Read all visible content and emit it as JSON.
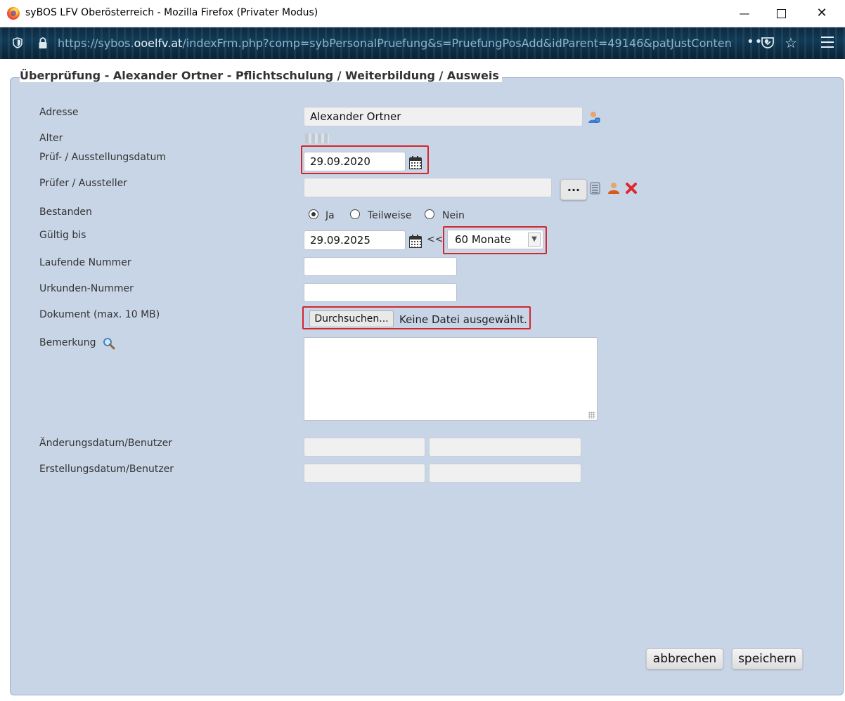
{
  "window": {
    "title": "syBOS LFV Oberösterreich - Mozilla Firefox (Privater Modus)",
    "controls": {
      "minimize": "—",
      "close": "✕"
    }
  },
  "navbar": {
    "url_prefix": "https://sybos.",
    "url_host": "ooelfv.at",
    "url_rest": "/indexFrm.php?comp=sybPersonalPruefung&s=PruefungPosAdd&idParent=49146&patJustContent=1&",
    "more_label": "•••",
    "star_label": "☆"
  },
  "page": {
    "title": "Überprüfung - Alexander Ortner - Pflichtschulung / Weiterbildung / Ausweis"
  },
  "form": {
    "adresse": {
      "label": "Adresse",
      "value": "Alexander Ortner"
    },
    "alter": {
      "label": "Alter"
    },
    "pruefdatum": {
      "label": "Prüf- / Ausstellungsdatum",
      "value": "29.09.2020"
    },
    "pruefer": {
      "label": "Prüfer / Aussteller",
      "value": "",
      "browse_label": "..."
    },
    "bestanden": {
      "label": "Bestanden",
      "options": [
        "Ja",
        "Teilweise",
        "Nein"
      ],
      "selected": "Ja"
    },
    "gueltig": {
      "label": "Gültig bis",
      "value": "29.09.2025",
      "arrow_label": "<<",
      "duration_value": "60 Monate"
    },
    "laufende_nummer": {
      "label": "Laufende Nummer",
      "value": ""
    },
    "urkunden_nummer": {
      "label": "Urkunden-Nummer",
      "value": ""
    },
    "dokument": {
      "label": "Dokument (max. 10 MB)",
      "button_label": "Durchsuchen...",
      "status": "Keine Datei ausgewählt."
    },
    "bemerkung": {
      "label": "Bemerkung",
      "value": ""
    },
    "aenderung": {
      "label": "Änderungsdatum/Benutzer"
    },
    "erstellung": {
      "label": "Erstellungsdatum/Benutzer"
    }
  },
  "actions": {
    "cancel_label": "abbrechen",
    "save_label": "speichern"
  },
  "colors": {
    "panel": "#c8d5e6",
    "highlight": "#d4262c",
    "navbar": "#123a55"
  }
}
